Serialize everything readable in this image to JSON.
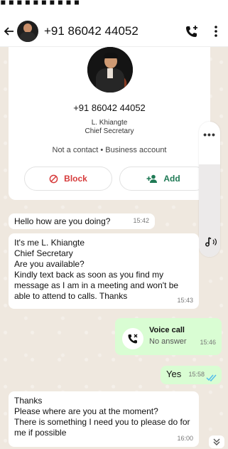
{
  "header": {
    "title": "+91 86042 44052"
  },
  "contact_card": {
    "phone": "+91 86042 44052",
    "name": "L. Khiangte",
    "role": "Chief Secretary",
    "note": "Not a contact • Business account",
    "block_label": "Block",
    "add_label": "Add"
  },
  "messages": [
    {
      "text": "Hello how are you doing?",
      "time": "15:42",
      "direction": "incoming"
    },
    {
      "text": "It's me L. Khiangte\nChief Secretary\nAre you available?\nKindly text back as soon as you find my message as I am in a meeting and won't be able to attend to calls. Thanks",
      "time": "15:43",
      "direction": "incoming"
    },
    {
      "title": "Voice call",
      "subtitle": "No answer",
      "time": "15:46",
      "direction": "outgoing"
    },
    {
      "text": "Yes",
      "time": "15:58",
      "direction": "outgoing",
      "status": "read"
    },
    {
      "text": "Thanks\nPlease where are you at the moment?\nThere is something I need you to please do for me if possible",
      "time": "16:00",
      "direction": "incoming"
    }
  ],
  "colors": {
    "outgoing_bubble": "#d9fdd3",
    "incoming_bubble": "#ffffff",
    "block": "#d63b3b",
    "add": "#1f7a55",
    "read_ticks": "#53bdeb"
  },
  "icons": [
    "back-arrow-icon",
    "add-call-icon",
    "more-vert-icon",
    "block-icon",
    "add-person-icon",
    "phone-missed-icon",
    "audio-icon",
    "chevron-down-icon"
  ]
}
